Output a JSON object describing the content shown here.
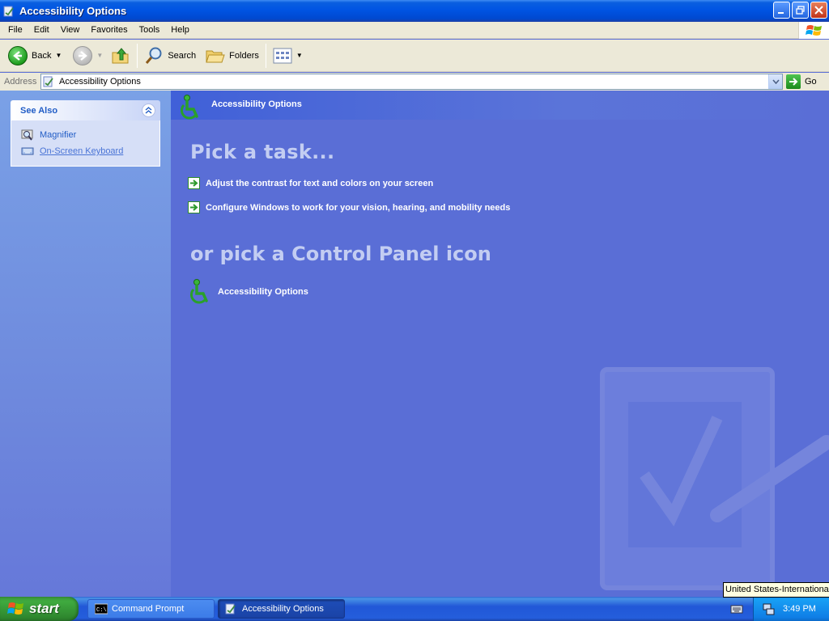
{
  "window": {
    "title": "Accessibility Options",
    "buttons": [
      "minimize",
      "maximize",
      "close"
    ]
  },
  "menubar": {
    "items": [
      "File",
      "Edit",
      "View",
      "Favorites",
      "Tools",
      "Help"
    ]
  },
  "toolbar": {
    "back_label": "Back",
    "search_label": "Search",
    "folders_label": "Folders"
  },
  "address": {
    "label": "Address",
    "value": "Accessibility Options",
    "go_label": "Go"
  },
  "see_also": {
    "title": "See Also",
    "links": [
      {
        "label": "Magnifier",
        "icon": "magnifier-icon"
      },
      {
        "label": "On-Screen Keyboard",
        "icon": "keyboard-icon"
      }
    ]
  },
  "main": {
    "header_title": "Accessibility Options",
    "pick_task": "Pick a task...",
    "tasks": [
      "Adjust the contrast for text and colors on your screen",
      "Configure Windows to work for your vision, hearing, and mobility needs"
    ],
    "or_pick": "or pick a Control Panel icon",
    "cp_icons": [
      {
        "label": "Accessibility Options",
        "icon": "accessibility-icon"
      }
    ]
  },
  "taskbar": {
    "start_label": "start",
    "tasks": [
      {
        "label": "Command Prompt",
        "icon": "cmd-icon",
        "active": false
      },
      {
        "label": "Accessibility Options",
        "icon": "accessibility-icon",
        "active": true
      }
    ],
    "clock": "3:49 PM",
    "language_tooltip": "United States-International"
  },
  "colors": {
    "titlebar": "#0054e3",
    "content_bg": "#5a6ed6",
    "link": "#215dc6",
    "heading_faded": "#c3cdf2"
  }
}
